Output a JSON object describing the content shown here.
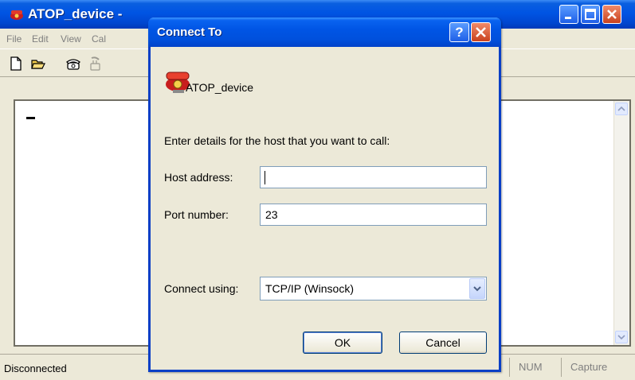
{
  "main_window": {
    "title": "ATOP_device -",
    "menu": [
      "File",
      "Edit",
      "View",
      "Cal"
    ],
    "status": {
      "connection": "Disconnected",
      "num": "NUM",
      "capture": "Capture"
    }
  },
  "dialog": {
    "title": "Connect To",
    "help_label": "?",
    "connection_name": "ATOP_device",
    "prompt": "Enter details for the host that you want to call:",
    "host_label": "Host address:",
    "host_value": "",
    "port_label": "Port number:",
    "port_value": "23",
    "connect_label": "Connect using:",
    "connect_value": "TCP/IP (Winsock)",
    "ok_label": "OK",
    "cancel_label": "Cancel"
  },
  "icons": {
    "app": "phone-icon",
    "new": "new-document-icon",
    "open": "open-folder-icon",
    "call": "call-phone-icon",
    "disconnect": "disconnect-phone-icon"
  },
  "colors": {
    "title_blue": "#0054e3",
    "close_red": "#c9421e",
    "dialog_bg": "#ece9d8"
  }
}
